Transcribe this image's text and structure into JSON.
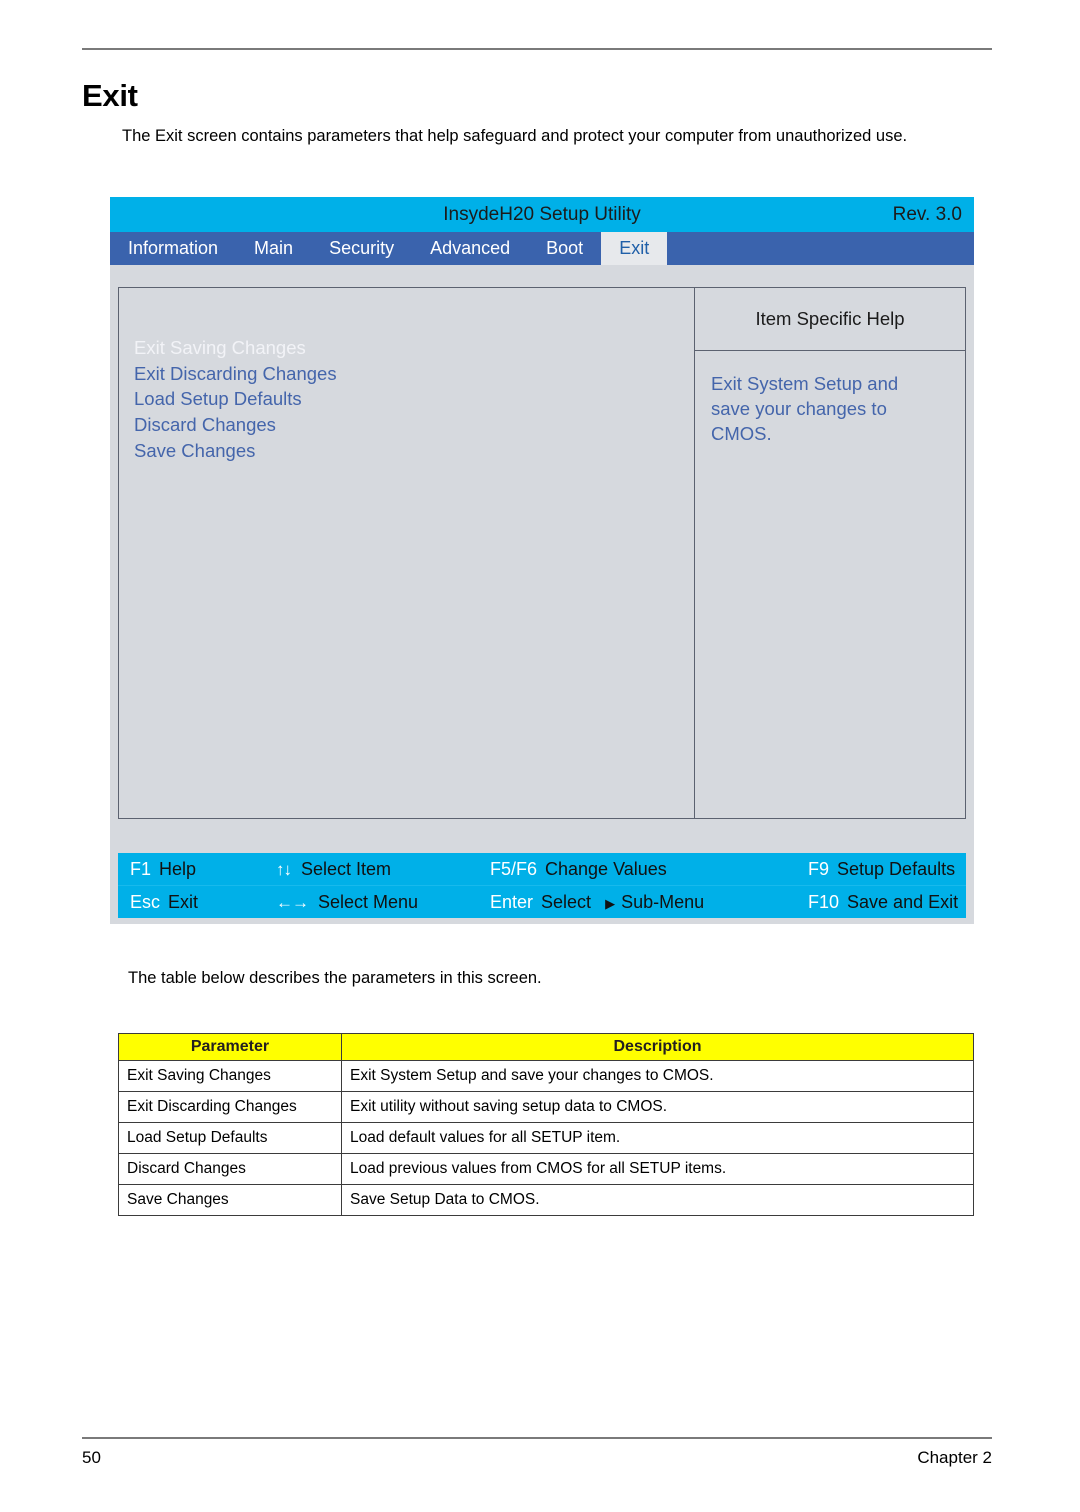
{
  "document": {
    "heading": "Exit",
    "intro": "The Exit screen contains parameters that help safeguard and protect your computer from unauthorized use.",
    "table_intro": "The table below describes the parameters in this screen.",
    "page_number": "50",
    "chapter": "Chapter 2"
  },
  "bios": {
    "title": "InsydeH20 Setup Utility",
    "revision": "Rev. 3.0",
    "tabs": [
      {
        "label": "Information",
        "active": false
      },
      {
        "label": "Main",
        "active": false
      },
      {
        "label": "Security",
        "active": false
      },
      {
        "label": "Advanced",
        "active": false
      },
      {
        "label": "Boot",
        "active": false
      },
      {
        "label": "Exit",
        "active": true
      }
    ],
    "menu_items": [
      {
        "label": "Exit Saving Changes",
        "selected": true
      },
      {
        "label": "Exit Discarding Changes",
        "selected": false
      },
      {
        "label": "Load Setup Defaults",
        "selected": false
      },
      {
        "label": "Discard Changes",
        "selected": false
      },
      {
        "label": "Save Changes",
        "selected": false
      }
    ],
    "help": {
      "title": "Item Specific Help",
      "lines": [
        "Exit System Setup and",
        "save your changes to",
        "CMOS."
      ]
    },
    "keybar": {
      "row1": [
        {
          "key": "F1",
          "desc": "Help"
        },
        {
          "arrows": "↑↓",
          "desc": "Select Item"
        },
        {
          "key": "F5/F6",
          "desc": "Change Values"
        },
        {
          "key": "F9",
          "desc": "Setup Defaults"
        }
      ],
      "row2": [
        {
          "key": "Esc",
          "desc": "Exit"
        },
        {
          "arrows": "←→",
          "desc": "Select Menu"
        },
        {
          "key": "Enter",
          "desc": "Select",
          "sub_arrow": "▶",
          "sub": "Sub-Menu"
        },
        {
          "key": "F10",
          "desc": "Save and Exit"
        }
      ]
    },
    "colors": {
      "title_bar": "#00b0e8",
      "tab_bar": "#3a63ad",
      "panel_bg": "#d6d9de",
      "menu_text": "#4465ab",
      "active_tab_bg": "#e7e9ec"
    }
  },
  "parameter_table": {
    "headers": [
      "Parameter",
      "Description"
    ],
    "header_bg": "#ffff00",
    "rows": [
      [
        "Exit Saving Changes",
        "Exit System Setup and save your changes to CMOS."
      ],
      [
        "Exit Discarding Changes",
        "Exit utility without saving setup data to CMOS."
      ],
      [
        "Load Setup Defaults",
        "Load default values for all SETUP item."
      ],
      [
        "Discard Changes",
        "Load previous values from CMOS for all SETUP items."
      ],
      [
        "Save Changes",
        "Save Setup Data to CMOS."
      ]
    ]
  }
}
